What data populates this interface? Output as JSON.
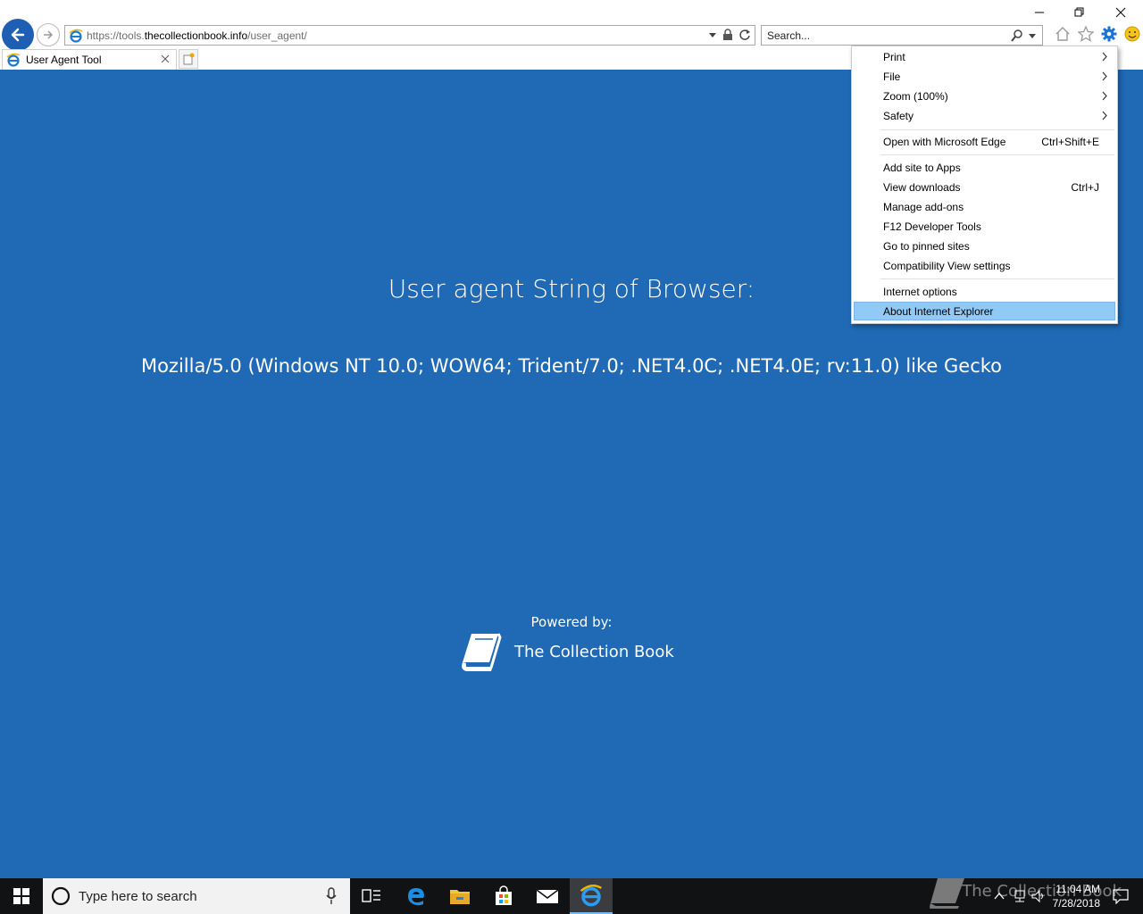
{
  "browser": {
    "address": {
      "url_prefix": "https://tools.",
      "url_domain": "thecollectionbook.info",
      "url_path": "/user_agent/"
    },
    "search": {
      "placeholder": "Search..."
    },
    "tab": {
      "title": "User Agent Tool"
    }
  },
  "page": {
    "heading": "User agent String of Browser:",
    "user_agent": "Mozilla/5.0 (Windows NT 10.0; WOW64; Trident/7.0; .NET4.0C; .NET4.0E; rv:11.0) like Gecko",
    "powered_by": "Powered by:",
    "brand_name": "The Collection Book"
  },
  "tools_menu": {
    "items": [
      {
        "label": "Print",
        "submenu": true
      },
      {
        "label": "File",
        "submenu": true
      },
      {
        "label": "Zoom (100%)",
        "submenu": true
      },
      {
        "label": "Safety",
        "submenu": true
      },
      {
        "label": "Open with Microsoft Edge",
        "shortcut": "Ctrl+Shift+E"
      },
      {
        "label": "Add site to Apps"
      },
      {
        "label": "View downloads",
        "shortcut": "Ctrl+J"
      },
      {
        "label": "Manage add-ons"
      },
      {
        "label": "F12 Developer Tools"
      },
      {
        "label": "Go to pinned sites"
      },
      {
        "label": "Compatibility View settings"
      },
      {
        "label": "Internet options"
      },
      {
        "label": "About Internet Explorer",
        "highlighted": true
      }
    ]
  },
  "taskbar": {
    "search_placeholder": "Type here to search",
    "clock_time": "11:04 AM",
    "clock_date": "7/28/2018",
    "watermark": "The Collection Book"
  },
  "colors": {
    "page_background": "#1f69b5",
    "menu_highlight": "#91c9f7",
    "taskbar": "#111214"
  }
}
